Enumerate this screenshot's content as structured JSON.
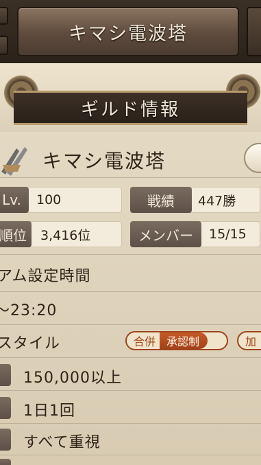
{
  "header": {
    "title": "キマシ電波塔"
  },
  "banner": {
    "title": "ギルド情報"
  },
  "guild": {
    "name": "キマシ電波塔",
    "stats": [
      {
        "label": "Lv.",
        "value": "100"
      },
      {
        "label": "戦績",
        "value": "447勝"
      },
      {
        "label": "順位",
        "value": "3,416位"
      },
      {
        "label": "メンバー",
        "value": "15/15"
      }
    ],
    "team_time_label": "アム設定時間",
    "team_time_value": "〜23:20",
    "style_label": "スタイル",
    "style_pill": {
      "left": "合併",
      "right": "承認制"
    },
    "style_pill2": "加",
    "requirements": [
      "150,000以上",
      "1日1回",
      "すべて重視"
    ]
  },
  "colors": {
    "accent": "#a0441a",
    "banner": "#2a211a",
    "parchment": "#e6dcc7"
  }
}
